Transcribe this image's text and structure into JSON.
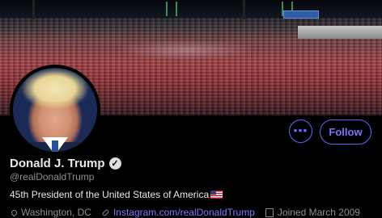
{
  "profile": {
    "name": "Donald J. Trump",
    "handle": "@realDonaldTrump",
    "bio": "45th President of the United States of America",
    "location": "Washington, DC",
    "website": "Instagram.com/realDonaldTrump",
    "joined": "Joined March 2009"
  },
  "actions": {
    "more_label": "•••",
    "follow_label": "Follow"
  },
  "icons": {
    "verified": "verified-badge-icon",
    "location": "location-pin-icon",
    "link": "link-icon",
    "calendar": "calendar-icon",
    "flag": "us-flag-emoji"
  },
  "colors": {
    "accent": "#7856ff",
    "background": "#000000",
    "secondary_text": "#8a8d91"
  }
}
